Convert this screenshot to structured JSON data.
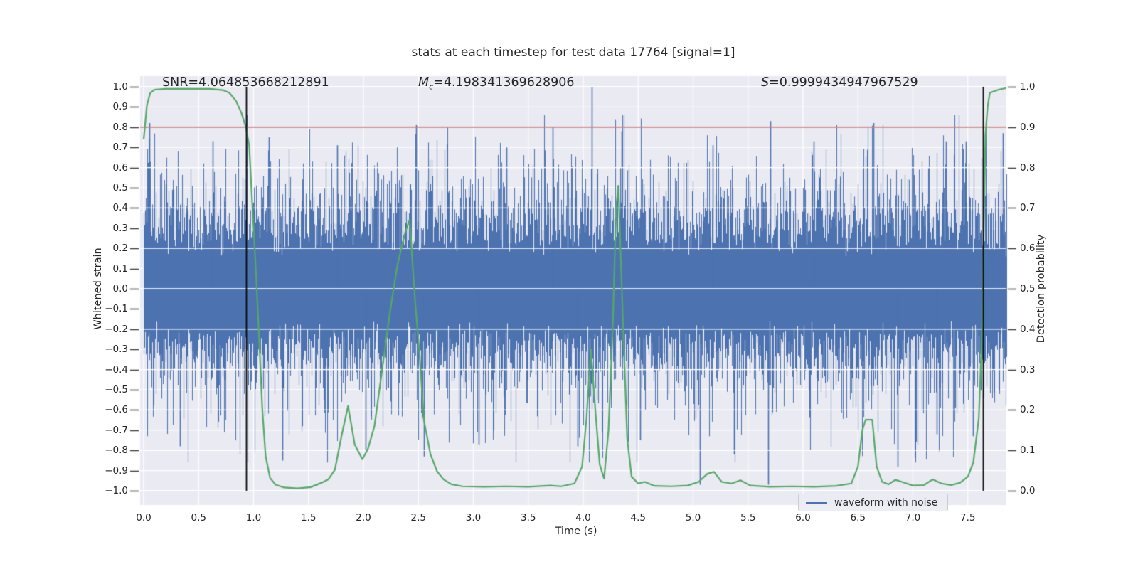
{
  "title": "stats at each timestep for test data 17764 [signal=1]",
  "annotations": {
    "snr": {
      "prefix": "SNR",
      "value": "=4.064853668212891"
    },
    "mc": {
      "prefix": "M",
      "sub": "c",
      "value": "=4.198341369628906"
    },
    "s": {
      "prefix": "S",
      "value": "=0.9999434947967529"
    }
  },
  "legend": {
    "label": "waveform with noise"
  },
  "axes": {
    "x": {
      "label": "Time (s)",
      "ticks": [
        0.0,
        0.5,
        1.0,
        1.5,
        2.0,
        2.5,
        3.0,
        3.5,
        4.0,
        4.5,
        5.0,
        5.5,
        6.0,
        6.5,
        7.0,
        7.5
      ],
      "min": -0.032,
      "max": 7.851
    },
    "y_left": {
      "label": "Whitened strain",
      "ticks": [
        1.0,
        0.9,
        0.8,
        0.7,
        0.6,
        0.5,
        0.4,
        0.3,
        0.2,
        0.1,
        0.0,
        -0.1,
        -0.2,
        -0.3,
        -0.4,
        -0.5,
        -0.6,
        -0.7,
        -0.8,
        -0.9,
        -1.0
      ],
      "min": -1.07,
      "max": 1.053
    },
    "y_right": {
      "label": "Detection probability",
      "ticks": [
        1.0,
        0.9,
        0.8,
        0.7,
        0.6,
        0.5,
        0.4,
        0.3,
        0.2,
        0.1,
        0.0
      ],
      "min": -0.035,
      "max": 1.026
    }
  },
  "colors": {
    "plot_bg": "#EAEAF2",
    "grid": "#FFFFFF",
    "waveform": "#4C72B0",
    "probability": "#55A868",
    "threshold": "#C44E52",
    "marker_line": "#0a0a0a",
    "text": "#262626"
  },
  "chart_data": {
    "type": "line",
    "title": "stats at each timestep for test data 17764 [signal=1]",
    "xlabel": "Time (s)",
    "ylabel_left": "Whitened strain",
    "ylabel_right": "Detection probability",
    "xlim": [
      -0.032,
      7.851
    ],
    "ylim_left": [
      -1.07,
      1.053
    ],
    "ylim_right": [
      -0.035,
      1.026
    ],
    "grid": true,
    "legend_position": "lower right",
    "threshold_line": {
      "axis": "right",
      "value": 0.9,
      "color": "#C44E52"
    },
    "vlines": [
      {
        "x": 0.932,
        "ymin": -1.0,
        "ymax": 1.0,
        "color": "#0a0a0a"
      },
      {
        "x": 7.639,
        "ymin": -1.0,
        "ymax": 1.0,
        "color": "#0a0a0a"
      }
    ],
    "series": [
      {
        "name": "waveform with noise",
        "kind": "noise_envelope",
        "axis": "left",
        "color": "#4C72B0",
        "t_range": [
          0,
          7.85
        ],
        "band_halfwidth": 0.18,
        "typical_peak": 0.45,
        "seed": 42,
        "spikes_up": [
          [
            0.05,
            0.82
          ],
          [
            0.63,
            0.73
          ],
          [
            1.14,
            0.75
          ],
          [
            1.76,
            0.71
          ],
          [
            2.48,
            0.81
          ],
          [
            3.3,
            0.7
          ],
          [
            3.72,
            0.8
          ],
          [
            4.08,
            1.0
          ],
          [
            4.35,
            0.78
          ],
          [
            5.18,
            0.71
          ],
          [
            5.7,
            0.83
          ],
          [
            6.1,
            0.73
          ],
          [
            6.64,
            0.82
          ],
          [
            7.3,
            0.73
          ],
          [
            7.48,
            0.73
          ],
          [
            7.82,
            0.77
          ]
        ],
        "spikes_down": [
          [
            0.33,
            -0.78
          ],
          [
            1.26,
            -0.85
          ],
          [
            2.02,
            -0.8
          ],
          [
            2.55,
            -0.83
          ],
          [
            3.05,
            -0.77
          ],
          [
            3.95,
            -0.78
          ],
          [
            4.52,
            -0.75
          ],
          [
            5.06,
            -0.97
          ],
          [
            5.37,
            -0.82
          ],
          [
            5.68,
            -0.97
          ],
          [
            6.86,
            -0.88
          ],
          [
            7.22,
            -0.72
          ],
          [
            7.55,
            -0.73
          ]
        ]
      },
      {
        "name": "detection probability",
        "kind": "line",
        "axis": "right",
        "color": "#55A868",
        "points": [
          [
            0.0,
            0.87
          ],
          [
            0.03,
            0.955
          ],
          [
            0.06,
            0.985
          ],
          [
            0.1,
            0.993
          ],
          [
            0.2,
            0.995
          ],
          [
            0.4,
            0.995
          ],
          [
            0.6,
            0.995
          ],
          [
            0.72,
            0.992
          ],
          [
            0.78,
            0.985
          ],
          [
            0.84,
            0.965
          ],
          [
            0.89,
            0.935
          ],
          [
            0.93,
            0.9
          ],
          [
            0.96,
            0.855
          ],
          [
            0.99,
            0.7
          ],
          [
            1.02,
            0.55
          ],
          [
            1.05,
            0.38
          ],
          [
            1.08,
            0.2
          ],
          [
            1.11,
            0.085
          ],
          [
            1.15,
            0.032
          ],
          [
            1.2,
            0.015
          ],
          [
            1.28,
            0.008
          ],
          [
            1.4,
            0.006
          ],
          [
            1.52,
            0.009
          ],
          [
            1.62,
            0.02
          ],
          [
            1.68,
            0.028
          ],
          [
            1.74,
            0.052
          ],
          [
            1.8,
            0.135
          ],
          [
            1.86,
            0.21
          ],
          [
            1.92,
            0.115
          ],
          [
            1.99,
            0.078
          ],
          [
            2.04,
            0.103
          ],
          [
            2.1,
            0.16
          ],
          [
            2.17,
            0.3
          ],
          [
            2.24,
            0.44
          ],
          [
            2.31,
            0.56
          ],
          [
            2.38,
            0.64
          ],
          [
            2.42,
            0.67
          ],
          [
            2.47,
            0.47
          ],
          [
            2.51,
            0.34
          ],
          [
            2.55,
            0.175
          ],
          [
            2.61,
            0.09
          ],
          [
            2.67,
            0.048
          ],
          [
            2.73,
            0.028
          ],
          [
            2.8,
            0.016
          ],
          [
            2.9,
            0.011
          ],
          [
            3.1,
            0.01
          ],
          [
            3.3,
            0.011
          ],
          [
            3.5,
            0.01
          ],
          [
            3.7,
            0.013
          ],
          [
            3.8,
            0.011
          ],
          [
            3.92,
            0.018
          ],
          [
            3.99,
            0.06
          ],
          [
            4.03,
            0.18
          ],
          [
            4.07,
            0.35
          ],
          [
            4.11,
            0.2
          ],
          [
            4.15,
            0.065
          ],
          [
            4.19,
            0.03
          ],
          [
            4.23,
            0.15
          ],
          [
            4.27,
            0.42
          ],
          [
            4.3,
            0.7
          ],
          [
            4.32,
            0.755
          ],
          [
            4.36,
            0.43
          ],
          [
            4.4,
            0.13
          ],
          [
            4.44,
            0.035
          ],
          [
            4.5,
            0.018
          ],
          [
            4.56,
            0.022
          ],
          [
            4.65,
            0.012
          ],
          [
            4.8,
            0.011
          ],
          [
            4.95,
            0.013
          ],
          [
            5.05,
            0.022
          ],
          [
            5.13,
            0.042
          ],
          [
            5.19,
            0.047
          ],
          [
            5.26,
            0.022
          ],
          [
            5.35,
            0.018
          ],
          [
            5.43,
            0.026
          ],
          [
            5.52,
            0.013
          ],
          [
            5.7,
            0.01
          ],
          [
            5.9,
            0.011
          ],
          [
            6.1,
            0.01
          ],
          [
            6.3,
            0.012
          ],
          [
            6.44,
            0.018
          ],
          [
            6.5,
            0.06
          ],
          [
            6.54,
            0.15
          ],
          [
            6.57,
            0.176
          ],
          [
            6.63,
            0.176
          ],
          [
            6.67,
            0.06
          ],
          [
            6.72,
            0.022
          ],
          [
            6.78,
            0.016
          ],
          [
            6.84,
            0.027
          ],
          [
            6.9,
            0.022
          ],
          [
            7.0,
            0.013
          ],
          [
            7.1,
            0.014
          ],
          [
            7.18,
            0.028
          ],
          [
            7.26,
            0.018
          ],
          [
            7.35,
            0.014
          ],
          [
            7.43,
            0.02
          ],
          [
            7.5,
            0.035
          ],
          [
            7.55,
            0.07
          ],
          [
            7.6,
            0.18
          ],
          [
            7.63,
            0.4
          ],
          [
            7.66,
            0.88
          ],
          [
            7.68,
            0.95
          ],
          [
            7.7,
            0.985
          ],
          [
            7.78,
            0.993
          ],
          [
            7.85,
            0.997
          ]
        ]
      }
    ]
  }
}
